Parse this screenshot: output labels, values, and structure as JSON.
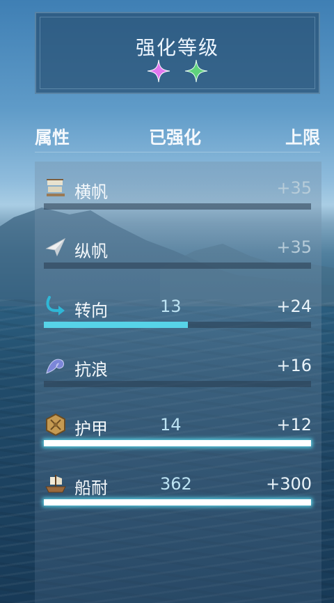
{
  "header": {
    "title": "强化等级",
    "stars": [
      {
        "icon": "pink-sparkle-star-icon",
        "color": "#e86ee8"
      },
      {
        "icon": "green-sparkle-star-icon",
        "color": "#59d37a"
      }
    ]
  },
  "columns": {
    "attribute": "属性",
    "enhanced": "已强化",
    "limit": "上限"
  },
  "stats": [
    {
      "name": "横帆",
      "icon": "square-sail-icon",
      "enhanced": "",
      "limit": "+35",
      "progress": 0
    },
    {
      "name": "纵帆",
      "icon": "fore-and-aft-sail-icon",
      "enhanced": "",
      "limit": "+35",
      "progress": 0
    },
    {
      "name": "转向",
      "icon": "turn-arrow-icon",
      "enhanced": "13",
      "limit": "+24",
      "progress": 0.54
    },
    {
      "name": "抗浪",
      "icon": "wave-icon",
      "enhanced": "",
      "limit": "+16",
      "progress": 0
    },
    {
      "name": "护甲",
      "icon": "armor-plate-icon",
      "enhanced": "14",
      "limit": "+12",
      "progress": 1.0
    },
    {
      "name": "船耐",
      "icon": "ship-durability-icon",
      "enhanced": "362",
      "limit": "+300",
      "progress": 1.0
    }
  ]
}
